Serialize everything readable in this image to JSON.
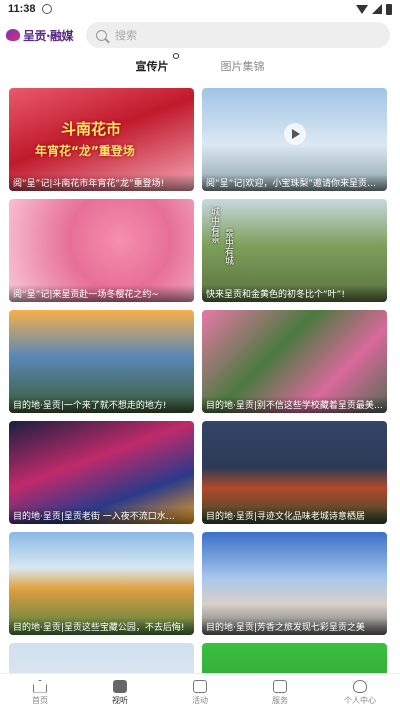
{
  "status": {
    "time": "11:38"
  },
  "header": {
    "logo_text": "呈贡·融媒",
    "search_placeholder": "搜索"
  },
  "tabs": [
    {
      "label": "宣传片",
      "active": true
    },
    {
      "label": "图片集锦",
      "active": false
    }
  ],
  "cards": [
    {
      "caption": "阅“呈”记|斗南花市年宵花“龙”重登场!",
      "overlay": "斗南花市",
      "overlay2": "年宵花“龙”重登场",
      "video": false
    },
    {
      "caption": "阅“呈”记|欢迎，小宝珠梨”邀请你来呈贡观…",
      "video": true
    },
    {
      "caption": "阅“呈”记|来呈贡赴一场冬樱花之约~",
      "video": false
    },
    {
      "caption": "快来呈贡和金黄色的初冬比个“叶”!",
      "vtext1": "城中有景",
      "vtext2": "景中有城",
      "video": false
    },
    {
      "caption": "目的地·呈贡|一个来了就不想走的地方!",
      "video": false
    },
    {
      "caption": "目的地·呈贡|别不信这些学校藏着呈贡最美…",
      "video": false
    },
    {
      "caption": "目的地·呈贡|呈贡老街 一入夜不流口水…",
      "video": false
    },
    {
      "caption": "目的地·呈贡|寻迹文化品味老城诗意栖居",
      "video": false
    },
    {
      "caption": "目的地·呈贡|呈贡这些宝藏公园，不去后悔!",
      "video": false
    },
    {
      "caption": "目的地·呈贡|芳香之旅发现七彩呈贡之美",
      "video": false
    },
    {
      "caption": "",
      "video": false
    },
    {
      "caption": "",
      "video": false
    }
  ],
  "bottom_nav": [
    {
      "label": "首页",
      "icon": "home-icon",
      "active": false
    },
    {
      "label": "视听",
      "icon": "video-icon",
      "active": true
    },
    {
      "label": "活动",
      "icon": "activity-icon",
      "active": false
    },
    {
      "label": "服务",
      "icon": "service-icon",
      "active": false
    },
    {
      "label": "个人中心",
      "icon": "heart-icon",
      "active": false
    }
  ]
}
